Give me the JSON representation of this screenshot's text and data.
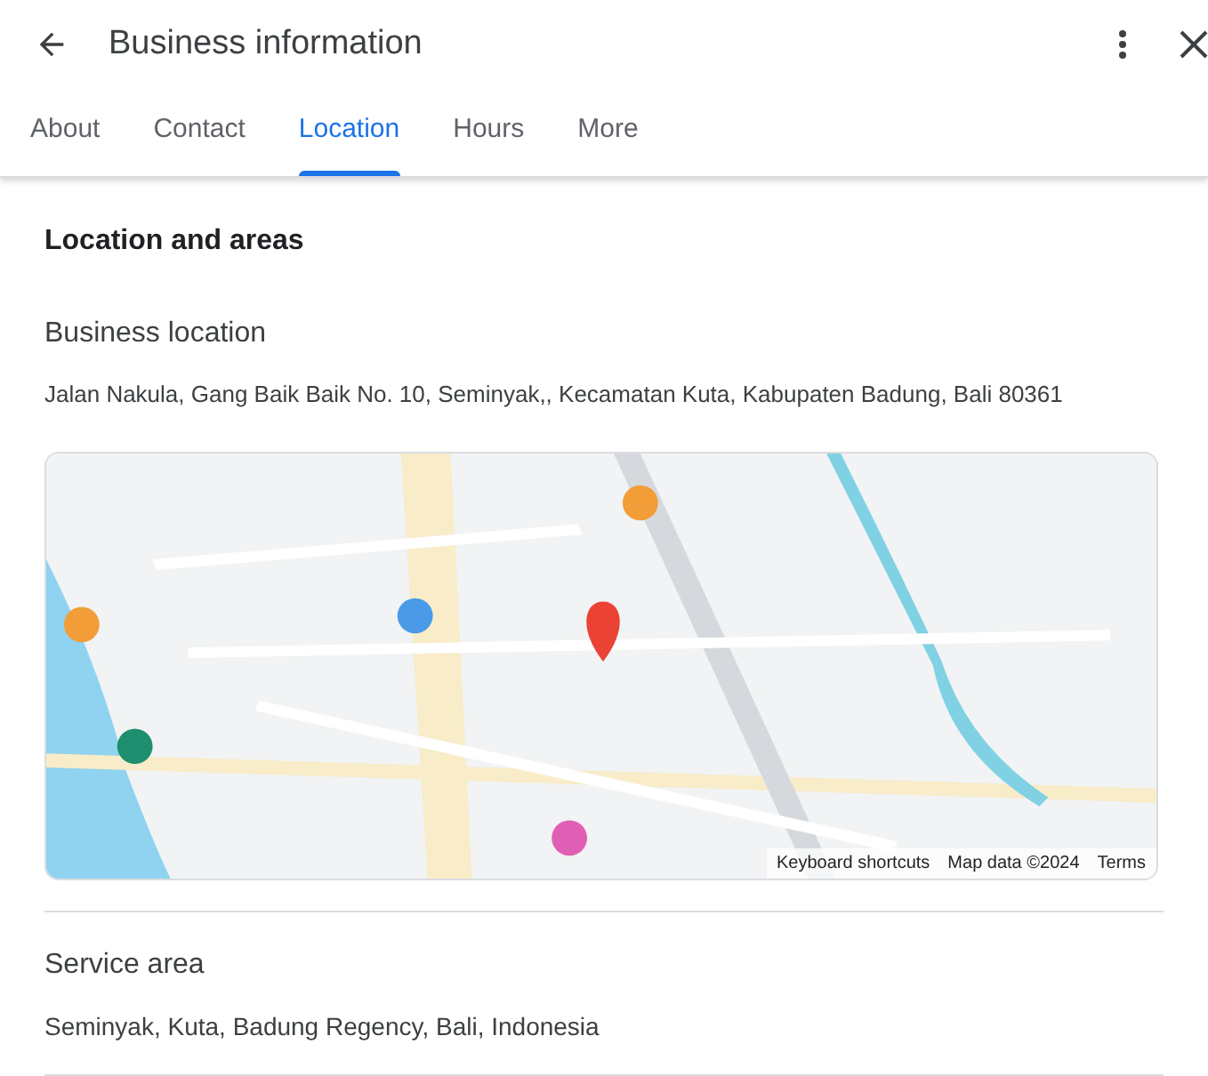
{
  "header": {
    "title": "Business information"
  },
  "tabs": [
    {
      "label": "About",
      "selected": false
    },
    {
      "label": "Contact",
      "selected": false
    },
    {
      "label": "Location",
      "selected": true
    },
    {
      "label": "Hours",
      "selected": false
    },
    {
      "label": "More",
      "selected": false
    }
  ],
  "section_title": "Location and areas",
  "business_location": {
    "label": "Business location",
    "address": "Jalan Nakula, Gang Baik Baik No. 10, Seminyak,, Kecamatan Kuta, Kabupaten Badung, Bali 80361"
  },
  "map": {
    "kind": "picture",
    "attribution": [
      "Keyboard shortcuts",
      "Map data ©2024",
      "Terms"
    ]
  },
  "service_area": {
    "label": "Service area",
    "value": "Seminyak, Kuta, Badung Regency, Bali, Indonesia"
  }
}
